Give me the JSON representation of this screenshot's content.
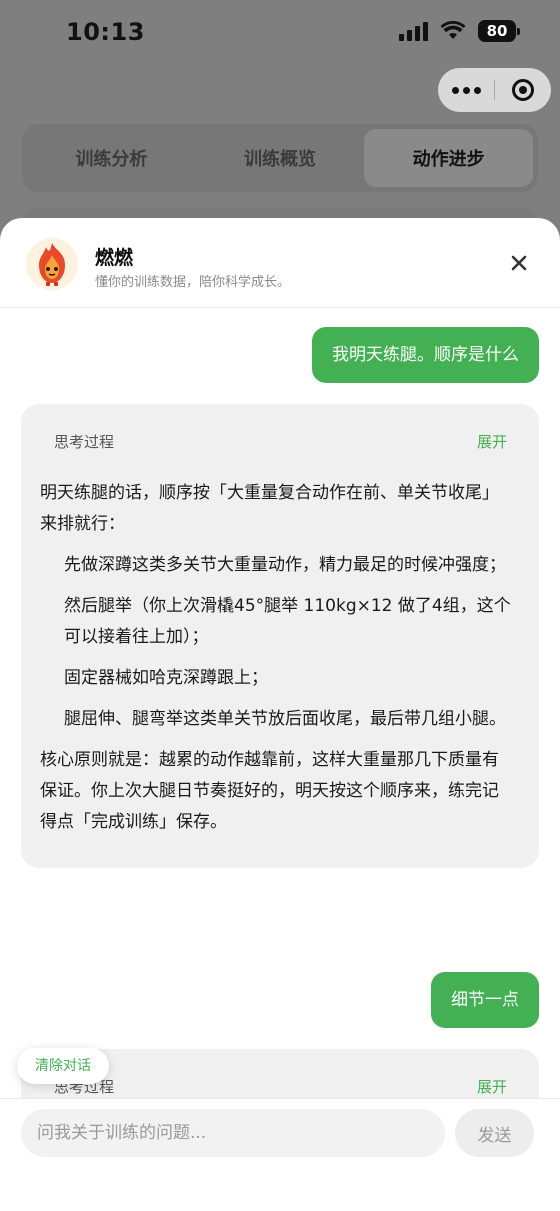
{
  "status_bar": {
    "time": "10:13",
    "battery": "80"
  },
  "tabs": [
    {
      "label": "训练分析",
      "active": false
    },
    {
      "label": "训练概览",
      "active": false
    },
    {
      "label": "动作进步",
      "active": true
    }
  ],
  "chat": {
    "bot_name": "燃燃",
    "bot_subtitle": "懂你的训练数据，陪你科学成长。",
    "messages": [
      {
        "role": "user",
        "text": "我明天练腿。顺序是什么"
      },
      {
        "role": "assistant",
        "thinking_label": "思考过程",
        "toggle_label": "展开",
        "paragraphs": [
          "明天练腿的话，顺序按「大重量复合动作在前、单关节收尾」来排就行：",
          "先做深蹲这类多关节大重量动作，精力最足的时候冲强度；",
          "然后腿举（你上次滑橇45°腿举 110kg×12 做了4组，这个可以接着往上加）；",
          "固定器械如哈克深蹲跟上；",
          "腿屈伸、腿弯举这类单关节放后面收尾，最后带几组小腿。",
          "核心原则就是：越累的动作越靠前，这样大重量那几下质量有保证。你上次大腿日节奏挺好的，明天按这个顺序来，练完记得点「完成训练」保存。"
        ]
      },
      {
        "role": "user",
        "text": "细节一点"
      },
      {
        "role": "assistant",
        "thinking_label": "思考过程",
        "toggle_label": "展开"
      }
    ],
    "clear_label": "清除对话",
    "input_placeholder": "问我关于训练的问题...",
    "send_label": "发送"
  },
  "colors": {
    "accent": "#43b153",
    "bubble_bg": "#f0f0f0",
    "overlay": "#7f7f7f"
  }
}
